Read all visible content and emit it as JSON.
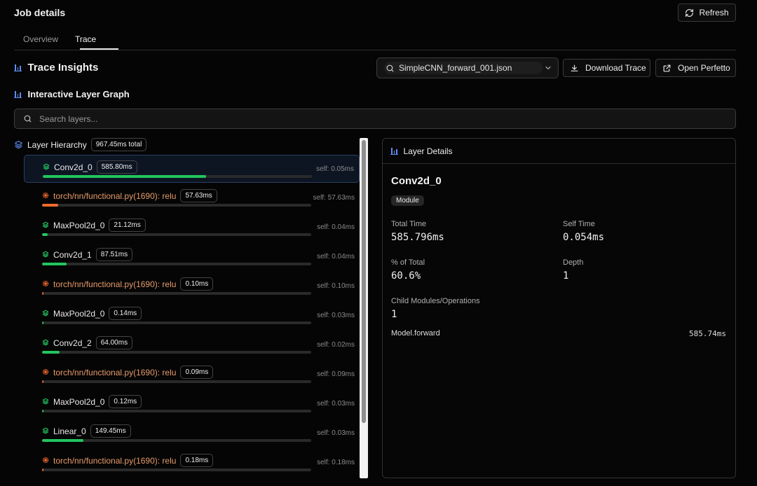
{
  "header": {
    "title": "Job details",
    "refresh_label": "Refresh"
  },
  "tabs": [
    {
      "label": "Overview",
      "active": false
    },
    {
      "label": "Trace",
      "active": true
    }
  ],
  "insights": {
    "title": "Trace Insights",
    "file_selected": "SimpleCNN_forward_001.json",
    "download_label": "Download Trace",
    "perfetto_label": "Open Perfetto"
  },
  "graph": {
    "title": "Interactive Layer Graph",
    "search_placeholder": "Search layers..."
  },
  "hierarchy": {
    "title": "Layer Hierarchy",
    "total": "967.45ms total",
    "layers": [
      {
        "name": "Conv2d_0",
        "time": "585.80ms",
        "self": "self: 0.05ms",
        "kind": "module",
        "fraction": 0.606,
        "selected": true
      },
      {
        "name": "torch/nn/functional.py(1690): relu",
        "time": "57.63ms",
        "self": "self: 57.63ms",
        "kind": "op",
        "fraction": 0.06
      },
      {
        "name": "MaxPool2d_0",
        "time": "21.12ms",
        "self": "self: 0.04ms",
        "kind": "module",
        "fraction": 0.022
      },
      {
        "name": "Conv2d_1",
        "time": "87.51ms",
        "self": "self: 0.04ms",
        "kind": "module",
        "fraction": 0.09
      },
      {
        "name": "torch/nn/functional.py(1690): relu",
        "time": "0.10ms",
        "self": "self: 0.10ms",
        "kind": "op",
        "fraction": 0
      },
      {
        "name": "MaxPool2d_0",
        "time": "0.14ms",
        "self": "self: 0.03ms",
        "kind": "module",
        "fraction": 0
      },
      {
        "name": "Conv2d_2",
        "time": "64.00ms",
        "self": "self: 0.02ms",
        "kind": "module",
        "fraction": 0.066
      },
      {
        "name": "torch/nn/functional.py(1690): relu",
        "time": "0.09ms",
        "self": "self: 0.09ms",
        "kind": "op",
        "fraction": 0
      },
      {
        "name": "MaxPool2d_0",
        "time": "0.12ms",
        "self": "self: 0.03ms",
        "kind": "module",
        "fraction": 0
      },
      {
        "name": "Linear_0",
        "time": "149.45ms",
        "self": "self: 0.03ms",
        "kind": "module",
        "fraction": 0.154
      },
      {
        "name": "torch/nn/functional.py(1690): relu",
        "time": "0.18ms",
        "self": "self: 0.18ms",
        "kind": "op",
        "fraction": 0
      }
    ]
  },
  "details": {
    "title": "Layer Details",
    "name": "Conv2d_0",
    "type": "Module",
    "total_time_label": "Total Time",
    "total_time": "585.796ms",
    "self_time_label": "Self Time",
    "self_time": "0.054ms",
    "pct_label": "% of Total",
    "pct": "60.6%",
    "depth_label": "Depth",
    "depth": "1",
    "children_label": "Child Modules/Operations",
    "children": "1",
    "parent_name": "Model.forward",
    "parent_time": "585.74ms"
  },
  "colors": {
    "accent": "#5b8df0",
    "module": "#22c55e",
    "op": "#f06a2e",
    "op_text": "#e79a6a"
  },
  "icons": {
    "refresh": "refresh-icon",
    "chart": "bar-chart-icon",
    "search": "search-icon",
    "download": "download-icon",
    "external": "external-link-icon",
    "layers": "layers-icon",
    "module": "module-layers-icon",
    "op": "operation-gear-icon",
    "chevron": "chevron-down-icon"
  }
}
